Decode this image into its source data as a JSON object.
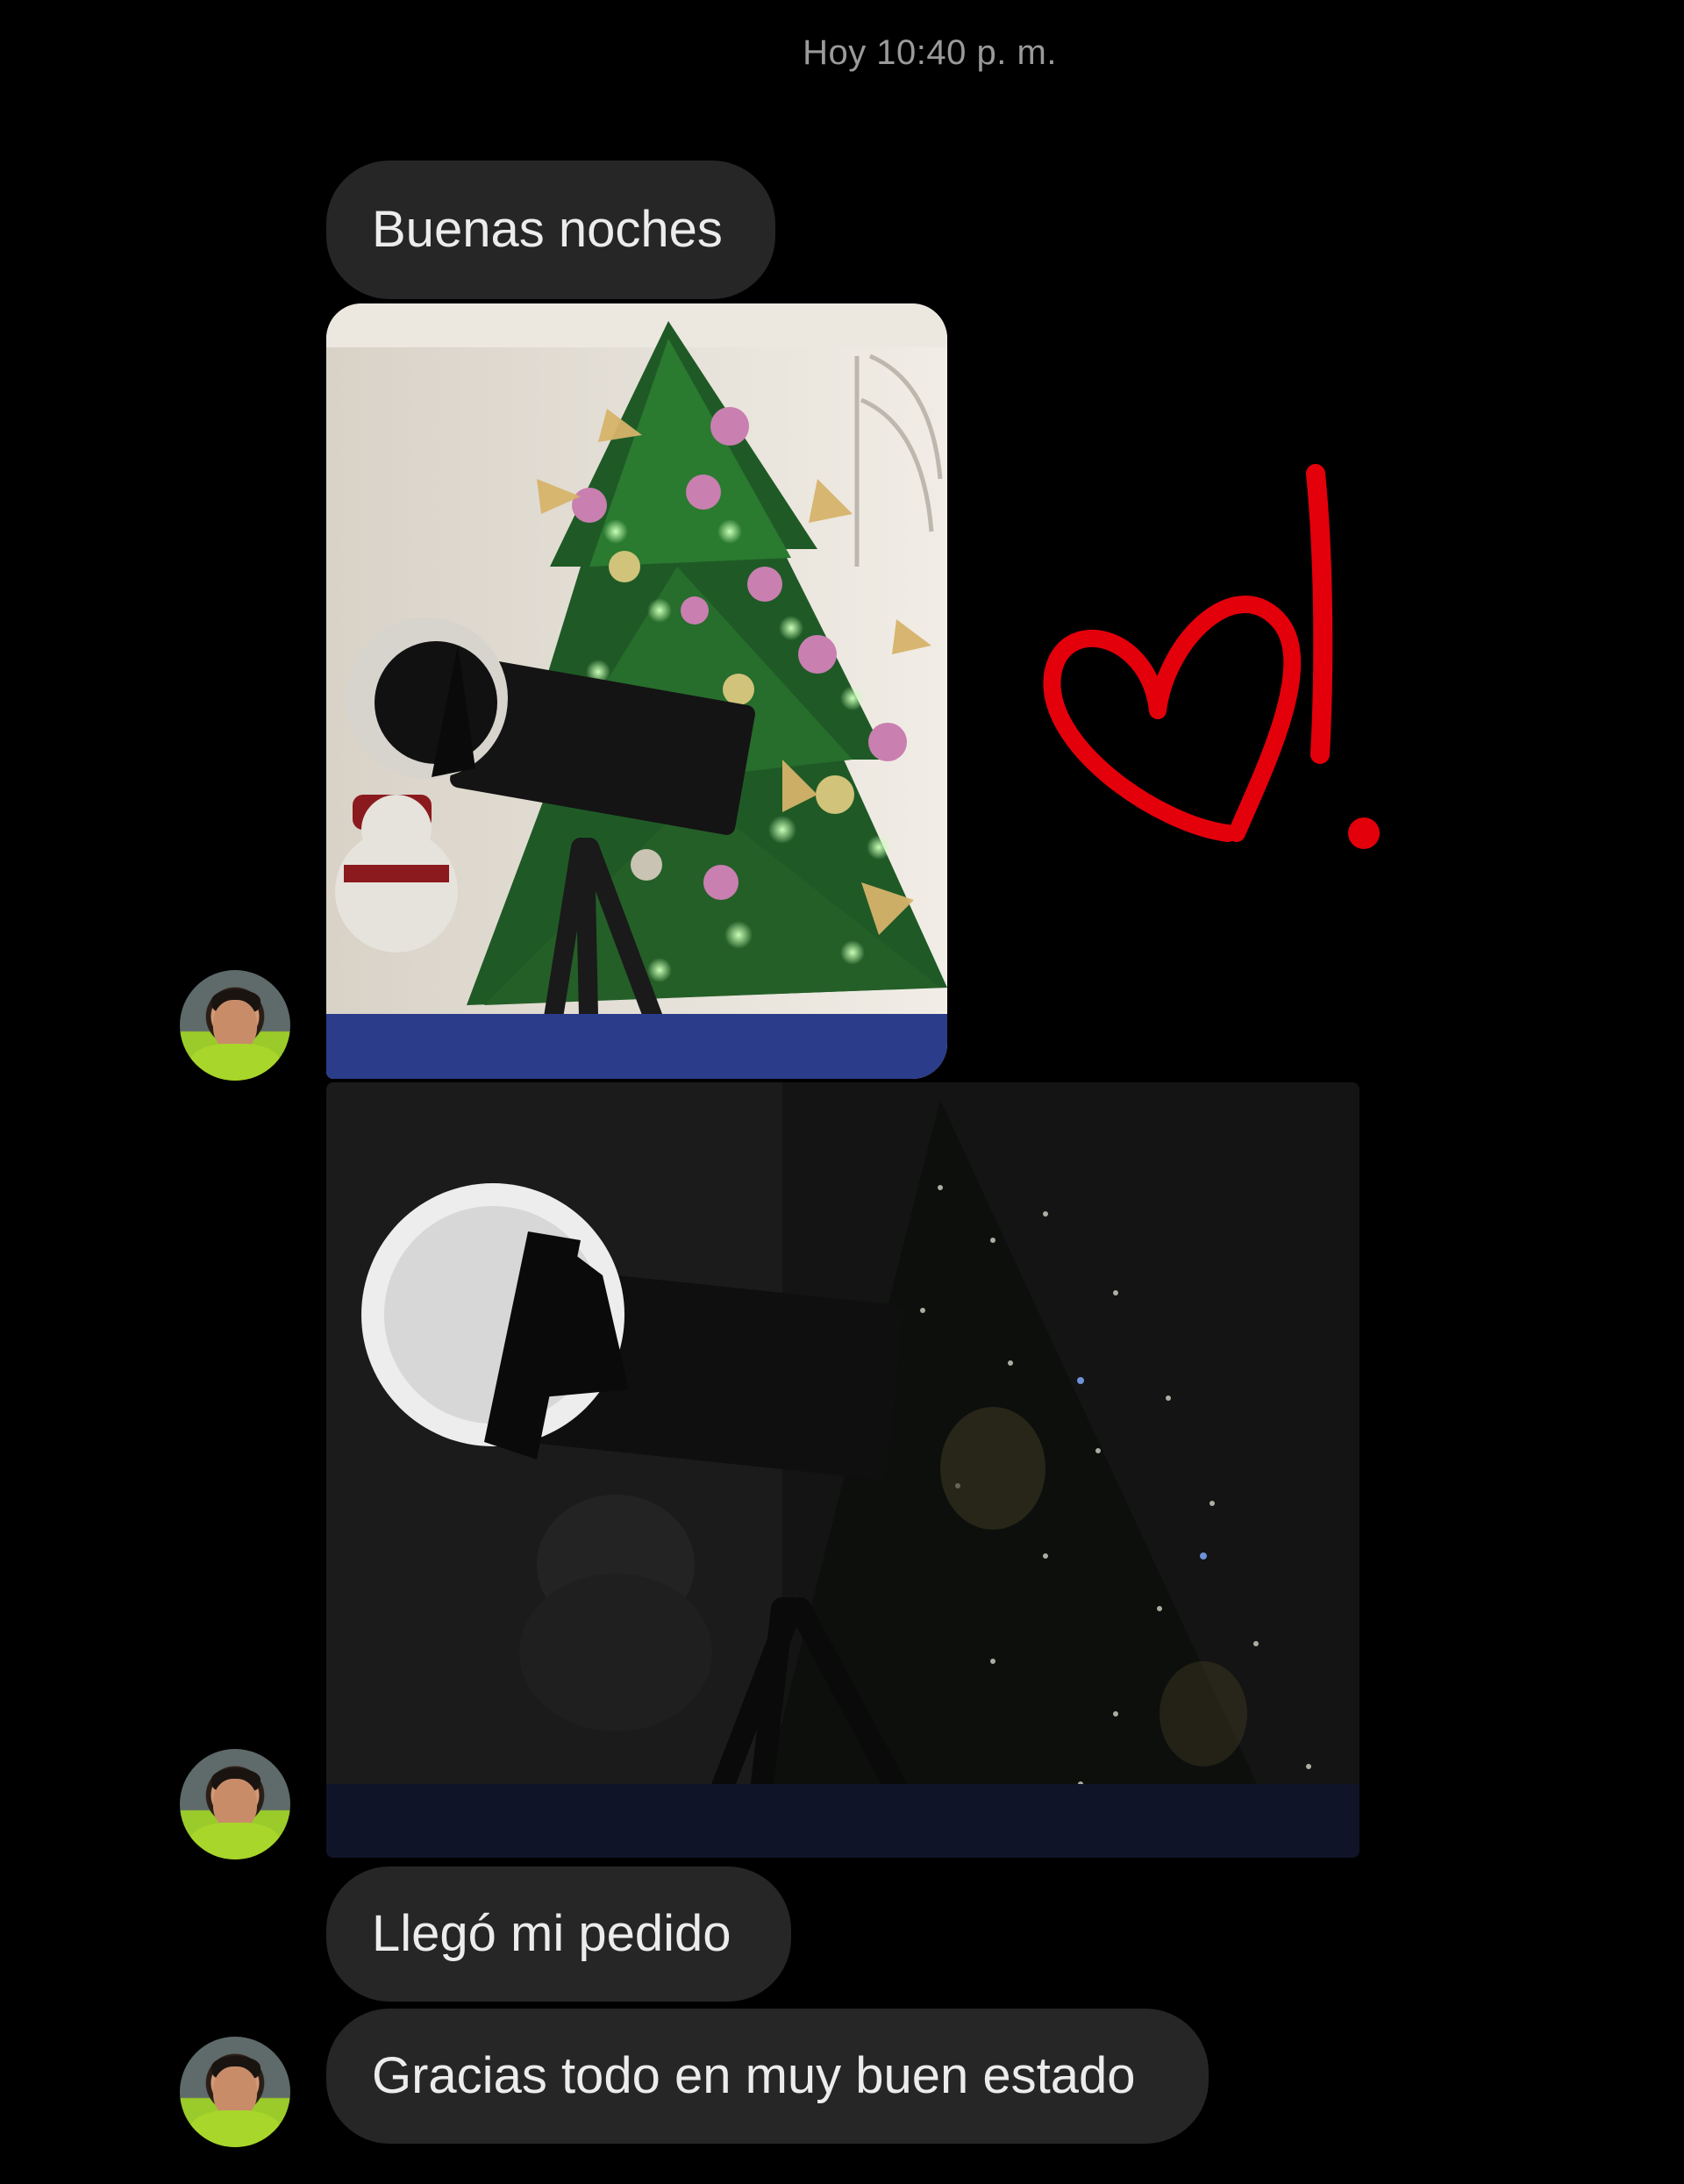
{
  "timestamp": "Hoy 10:40 p. m.",
  "messages": [
    {
      "type": "text",
      "text": "Buenas noches"
    },
    {
      "type": "image",
      "alt_icon": "christmas-tree-telescope-photo"
    },
    {
      "type": "image",
      "alt_icon": "dark-telescope-photo"
    },
    {
      "type": "text",
      "text": "Llegó mi pedido"
    },
    {
      "type": "text",
      "text": "Gracias todo en muy buen estado"
    }
  ],
  "reaction": {
    "icon": "heart-exclamation-drawing",
    "color": "#e3000b"
  }
}
